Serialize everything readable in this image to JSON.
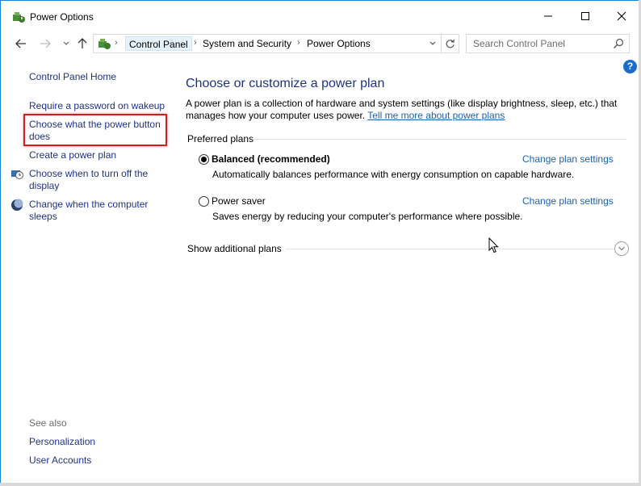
{
  "window": {
    "title": "Power Options"
  },
  "address": {
    "crumbs": [
      "Control Panel",
      "System and Security",
      "Power Options"
    ],
    "search_placeholder": "Search Control Panel"
  },
  "help": {
    "label": "?"
  },
  "sidebar": {
    "items": [
      {
        "label": "Control Panel Home"
      },
      {
        "label": "Require a password on wakeup"
      },
      {
        "label": "Choose what the power button does"
      },
      {
        "label": "Create a power plan"
      },
      {
        "label": "Choose when to turn off the display"
      },
      {
        "label": "Change when the computer sleeps"
      }
    ],
    "see_also_label": "See also",
    "see_also": [
      {
        "label": "Personalization"
      },
      {
        "label": "User Accounts"
      }
    ]
  },
  "main": {
    "title": "Choose or customize a power plan",
    "description": "A power plan is a collection of hardware and system settings (like display brightness, sleep, etc.) that manages how your computer uses power.",
    "description_link": "Tell me more about power plans",
    "preferred_label": "Preferred plans",
    "plans": [
      {
        "name": "Balanced (recommended)",
        "description": "Automatically balances performance with energy consumption on capable hardware.",
        "link": "Change plan settings",
        "selected": true
      },
      {
        "name": "Power saver",
        "description": "Saves energy by reducing your computer's performance where possible.",
        "link": "Change plan settings",
        "selected": false
      }
    ],
    "show_more_label": "Show additional plans"
  },
  "colors": {
    "link": "#1e3287",
    "link_bright": "#1a5fb4",
    "highlight": "#d01f1f",
    "window_border": "#1883d7"
  }
}
